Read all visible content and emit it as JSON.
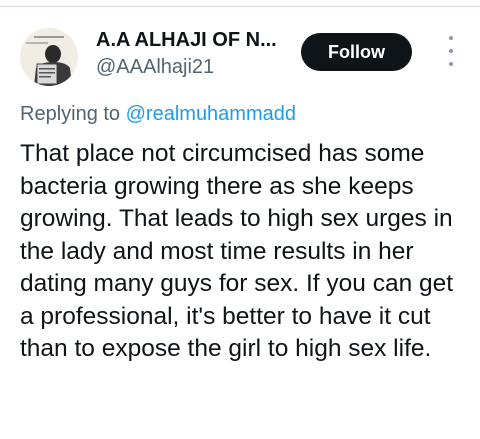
{
  "tweet": {
    "display_name": "A.A ALHAJI OF N...",
    "handle": "@AAAlhaji21",
    "follow_label": "Follow",
    "replying_prefix": "Replying to",
    "replying_to": "@realmuhammadd",
    "text": "That place not circumcised has some bacteria growing there as she keeps growing. That leads to high sex urges in the lady and most time results in her dating many guys for sex. If you can get a professional, it's better to have it cut than to expose the girl to high sex life."
  },
  "icons": {
    "more": "more-vertical-icon",
    "avatar": "avatar"
  },
  "colors": {
    "text": "#0f1419",
    "secondary": "#536471",
    "link": "#1d9bf0",
    "button_bg": "#0f1419",
    "button_text": "#ffffff"
  }
}
